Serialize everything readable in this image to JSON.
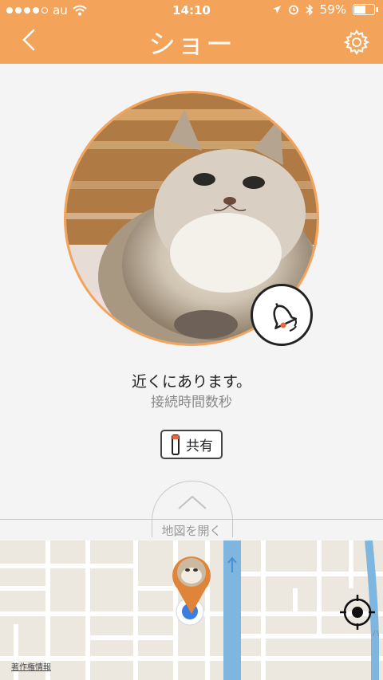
{
  "status_bar": {
    "carrier": "au",
    "time": "14:10",
    "battery": "59%",
    "battery_level": 0.59
  },
  "header": {
    "title": "ショー",
    "back_icon": "chevron-left-icon",
    "settings_icon": "gear-icon"
  },
  "device": {
    "status": "近くにあります。",
    "sub_status": "接続時間数秒",
    "bell_icon": "bell-icon"
  },
  "share": {
    "label": "共有"
  },
  "map_toggle": {
    "label": "地図を開く"
  },
  "map": {
    "copyright": "著作権情報"
  },
  "colors": {
    "accent": "#f4a45a",
    "water": "#7fb6df",
    "map_bg": "#ece7df"
  }
}
